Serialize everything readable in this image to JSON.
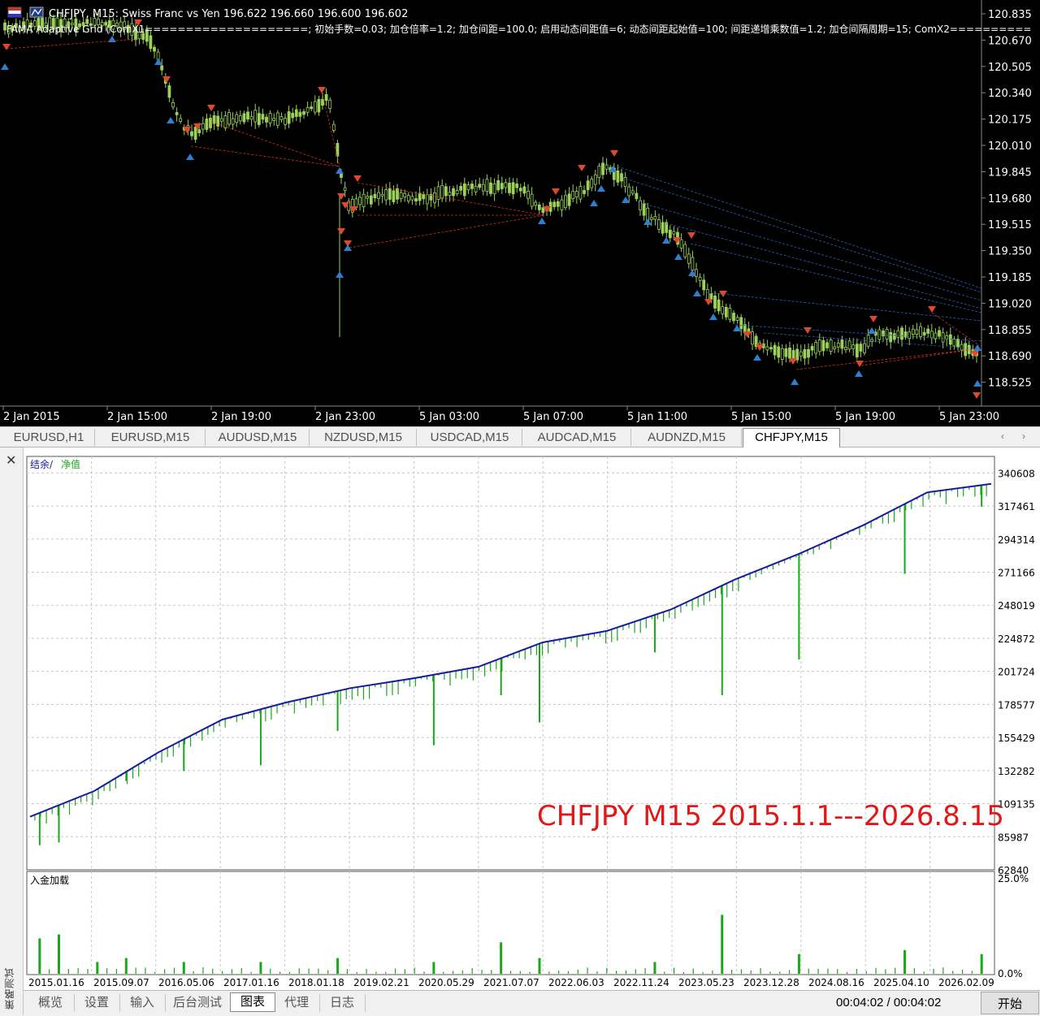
{
  "price_chart": {
    "header_line": "CHFJPY, M15:  Swiss Franc vs Yen  196.622 196.660 196.600 196.602",
    "indicator_line": "FAMA Adaptive Grid (ComX1====================; 初始手数=0.03; 加仓倍率=1.2; 加仓间距=100.0; 启用动态间距值=6; 动态间距起始值=100; 间距递增乘数值=1.2; 加仓间隔周期=15; ComX2==========",
    "y_ticks": [
      "120.835",
      "120.670",
      "120.505",
      "120.340",
      "120.175",
      "120.010",
      "119.845",
      "119.680",
      "119.515",
      "119.350",
      "119.185",
      "119.020",
      "118.855",
      "118.690",
      "118.525"
    ],
    "x_ticks": [
      "2 Jan 2015",
      "2 Jan 15:00",
      "2 Jan 19:00",
      "2 Jan 23:00",
      "5 Jan 03:00",
      "5 Jan 07:00",
      "5 Jan 11:00",
      "5 Jan 15:00",
      "5 Jan 19:00",
      "5 Jan 23:00"
    ],
    "colors": {
      "background": "#000000",
      "bull": "#9cd15a",
      "bear": "#ffffff",
      "sell_arrow": "#e0472c",
      "buy_arrow": "#2e7fd1",
      "sell_line": "#d03020",
      "buy_line": "#2a5fb5"
    }
  },
  "symbol_tabs": [
    "EURUSD,H1",
    "EURUSD,M15",
    "AUDUSD,M15",
    "NZDUSD,M15",
    "USDCAD,M15",
    "AUDCAD,M15",
    "AUDNZD,M15",
    "CHFJPY,M15"
  ],
  "symbol_tab_active": "CHFJPY,M15",
  "tab_scroll": {
    "left": "‹",
    "right": "›"
  },
  "tester": {
    "side_title": "策略测试",
    "close_glyph": "✕",
    "legend_balance": "结余",
    "legend_sep": " / ",
    "legend_equity": "净值",
    "overlay_text": "CHFJPY M15 2015.1.1---2026.8.15",
    "deposit_title": "入金加载",
    "deposit_ticks": [
      "25.0%",
      "0.0%"
    ],
    "colors": {
      "balance": "#1a1aa0",
      "equity": "#1aa81a",
      "overlay": "#e01818",
      "grid": "#c8c8c8"
    }
  },
  "bottom_tabs": [
    "概览",
    "设置",
    "输入",
    "后台测试",
    "图表",
    "代理",
    "日志"
  ],
  "bottom_tab_active": "图表",
  "time_readout": "00:04:02 / 00:04:02",
  "start_button": "开始",
  "chart_data": {
    "type": "line",
    "title": "",
    "xlabel": "",
    "ylabel": "",
    "x": [
      "2015.01.16",
      "2015.09.07",
      "2016.05.06",
      "2017.01.16",
      "2018.01.18",
      "2019.02.21",
      "2020.05.29",
      "2021.07.07",
      "2022.06.03",
      "2022.11.24",
      "2023.05.23",
      "2023.12.28",
      "2024.08.16",
      "2025.04.10",
      "2026.02.09"
    ],
    "ylim": [
      62840,
      352181
    ],
    "y_ticks": [
      340608,
      317461,
      294314,
      271166,
      248019,
      224872,
      201724,
      178577,
      155429,
      132282,
      109135,
      85987,
      62840
    ],
    "grid": true,
    "series": [
      {
        "name": "结余",
        "values": [
          100000,
          118000,
          145000,
          168000,
          180000,
          190000,
          197000,
          205000,
          222000,
          230000,
          245000,
          266000,
          284000,
          304000,
          327000,
          333000
        ]
      },
      {
        "name": "净值",
        "values": [
          100000,
          118000,
          145000,
          168000,
          180000,
          190000,
          197000,
          205000,
          222000,
          230000,
          245000,
          266000,
          284000,
          304000,
          327000,
          333000
        ]
      }
    ],
    "equity_drawdowns": [
      {
        "x": 0.01,
        "low": 80000
      },
      {
        "x": 0.03,
        "low": 82000
      },
      {
        "x": 0.1,
        "low": 125000
      },
      {
        "x": 0.16,
        "low": 132000
      },
      {
        "x": 0.24,
        "low": 136000
      },
      {
        "x": 0.32,
        "low": 160000
      },
      {
        "x": 0.42,
        "low": 150000
      },
      {
        "x": 0.49,
        "low": 185000
      },
      {
        "x": 0.53,
        "low": 166000
      },
      {
        "x": 0.65,
        "low": 215000
      },
      {
        "x": 0.72,
        "low": 185000
      },
      {
        "x": 0.8,
        "low": 210000
      },
      {
        "x": 0.91,
        "low": 270000
      },
      {
        "x": 0.99,
        "low": 317000
      }
    ],
    "deposit_load_percent": [
      {
        "x": 0.01,
        "v": 9
      },
      {
        "x": 0.03,
        "v": 10
      },
      {
        "x": 0.07,
        "v": 3
      },
      {
        "x": 0.1,
        "v": 4
      },
      {
        "x": 0.16,
        "v": 3
      },
      {
        "x": 0.24,
        "v": 3
      },
      {
        "x": 0.32,
        "v": 4
      },
      {
        "x": 0.42,
        "v": 3
      },
      {
        "x": 0.49,
        "v": 8
      },
      {
        "x": 0.53,
        "v": 4
      },
      {
        "x": 0.65,
        "v": 3
      },
      {
        "x": 0.72,
        "v": 15
      },
      {
        "x": 0.8,
        "v": 5
      },
      {
        "x": 0.91,
        "v": 6
      },
      {
        "x": 0.99,
        "v": 5
      }
    ]
  }
}
